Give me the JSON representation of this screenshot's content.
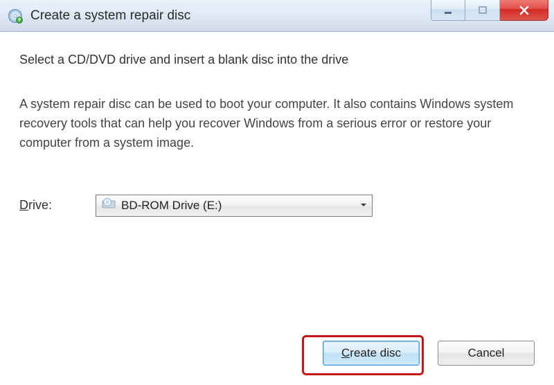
{
  "window": {
    "title": "Create a system repair disc"
  },
  "content": {
    "heading": "Select a CD/DVD drive and insert a blank disc into the drive",
    "description": "A system repair disc can be used to boot your computer. It also contains Windows system recovery tools that can help you recover Windows from a serious error or restore your computer from a system image."
  },
  "drive": {
    "label_prefix": "D",
    "label_rest": "rive:",
    "selected": "BD-ROM Drive (E:)"
  },
  "buttons": {
    "create_prefix": "C",
    "create_rest": "reate disc",
    "cancel": "Cancel"
  }
}
